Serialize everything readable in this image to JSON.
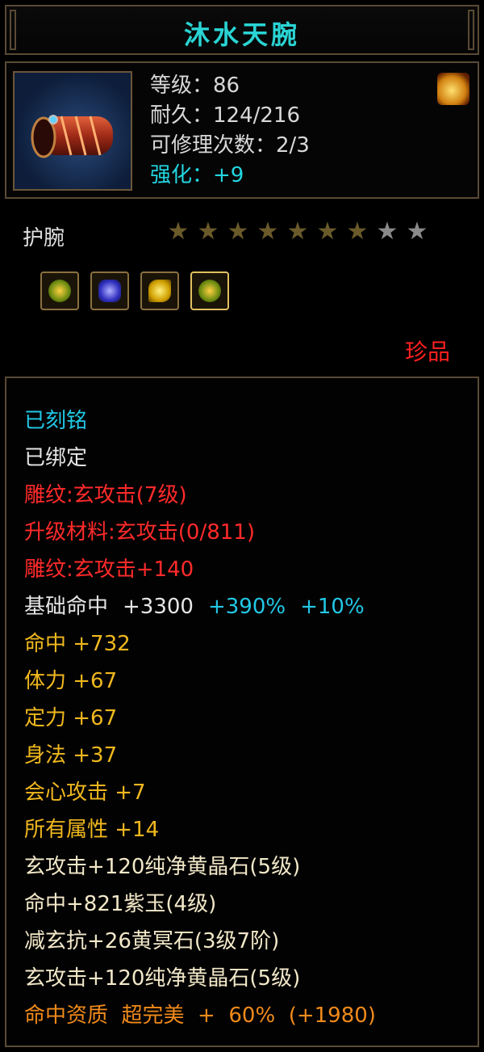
{
  "item": {
    "name": "沐水天腕",
    "level": "等级：86",
    "durability": "耐久：124/216",
    "repairs": "可修理次数：2/3",
    "enhance": "强化：+9",
    "type": "护腕",
    "stars_filled": 7,
    "stars_total": 9,
    "rarity": "珍品",
    "icon": "bracer-icon",
    "badge_icon": "flame-icon"
  },
  "gems": [
    {
      "icon": "green-gold-gem-icon",
      "selected": false
    },
    {
      "icon": "blue-crystal-gem-icon",
      "selected": false
    },
    {
      "icon": "yellow-crystal-gem-icon",
      "selected": false
    },
    {
      "icon": "green-gold-gem-icon",
      "selected": true
    }
  ],
  "lines": {
    "engraved": "已刻铭",
    "bound": "已绑定",
    "carving1": "雕纹:玄攻击(7级)",
    "upgrade": "升级材料:玄攻击(0/811)",
    "carving2": "雕纹:玄攻击+140",
    "base_label": "基础命中",
    "base_value": "+3300",
    "base_pct1": "+390%",
    "base_pct2": "+10%",
    "hit": "命中  +732",
    "stamina": "体力  +67",
    "focus": "定力  +67",
    "agility": "身法  +37",
    "crit": "会心攻击  +7",
    "all": "所有属性  +14",
    "gem1": "玄攻击+120纯净黄晶石(5级)",
    "gem2": "命中+821紫玉(4级)",
    "gem3": "减玄抗+26黄冥石(3级7阶)",
    "gem4": "玄攻击+120纯净黄晶石(5级)",
    "quality": "命中资质  超完美  +  60%  (+1980)"
  },
  "colors": {
    "title": "#2ad4d4",
    "cyan": "#22c8e6",
    "red": "#ff2a2a",
    "gold": "#f0b81e",
    "orange": "#f08a1a",
    "border": "#5a4a34"
  }
}
